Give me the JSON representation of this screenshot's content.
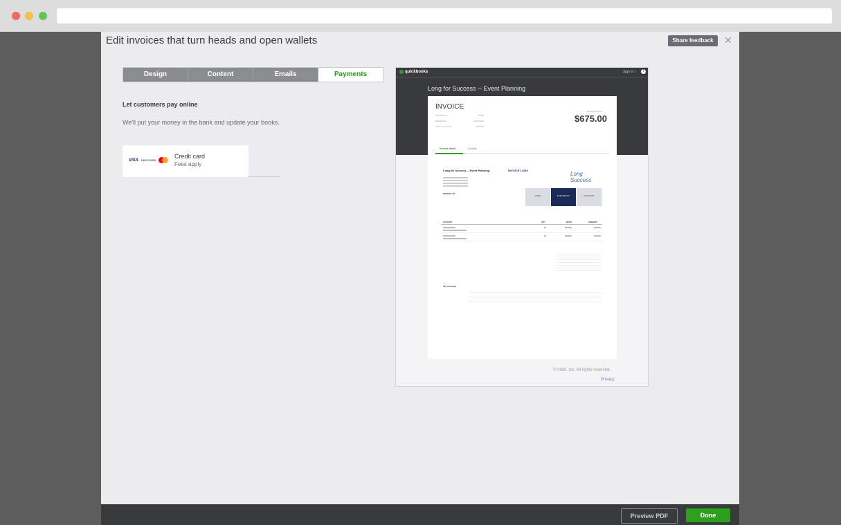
{
  "modal": {
    "title": "Edit invoices that turn heads and open wallets",
    "feedback_label": "Share feedback",
    "close_glyph": "✕"
  },
  "tabs": [
    {
      "label": "Design",
      "active": false
    },
    {
      "label": "Content",
      "active": false
    },
    {
      "label": "Emails",
      "active": false
    },
    {
      "label": "Payments",
      "active": true
    }
  ],
  "payments": {
    "heading": "Let customers pay online",
    "description": "We'll put your money in the bank and update your books.",
    "credit_card": {
      "title": "Credit card",
      "subtitle": "Fees apply",
      "logos": [
        "VISA",
        "DISCOVER",
        "mastercard"
      ]
    }
  },
  "preview": {
    "brand": "quickbooks",
    "sign_in": "Sign in |",
    "help_glyph": "?",
    "business_name": "Long for Success -- Event Planning",
    "invoice": {
      "title": "INVOICE",
      "balance_label": "BALANCE DUE",
      "amount": "$675.00",
      "meta": [
        {
          "label": "INVOICE No.",
          "value": "12345"
        },
        {
          "label": "DUE DATE",
          "value": "01/01/2015"
        },
        {
          "label": "Amount enclosed",
          "value": "$675.00"
        }
      ],
      "tabs": [
        "Invoice detail",
        "Activity"
      ],
      "doc_business": "Long for Success -- Event Planning",
      "doc_invoice_no": "INVOICE 12345",
      "doc_logo": "Long Success",
      "doc_billto": "INVOICE TO",
      "doc_boxes": [
        "DATE",
        "PLEASE PAY",
        "DUE DATE"
      ],
      "doc_columns": [
        "ACTIVITY",
        "QTY",
        "RATE",
        "AMOUNT"
      ],
      "doc_tax_summary": "Tax summary"
    },
    "copyright": "© Intuit, Inc. All rights reserved.",
    "privacy": "Privacy"
  },
  "footer": {
    "preview_pdf_label": "Preview PDF",
    "done_label": "Done"
  },
  "colors": {
    "accent_green": "#2ca01c",
    "tab_inactive": "#8b8c90",
    "dark_surface": "#393a3d",
    "invoice_navy": "#1b2a57"
  }
}
